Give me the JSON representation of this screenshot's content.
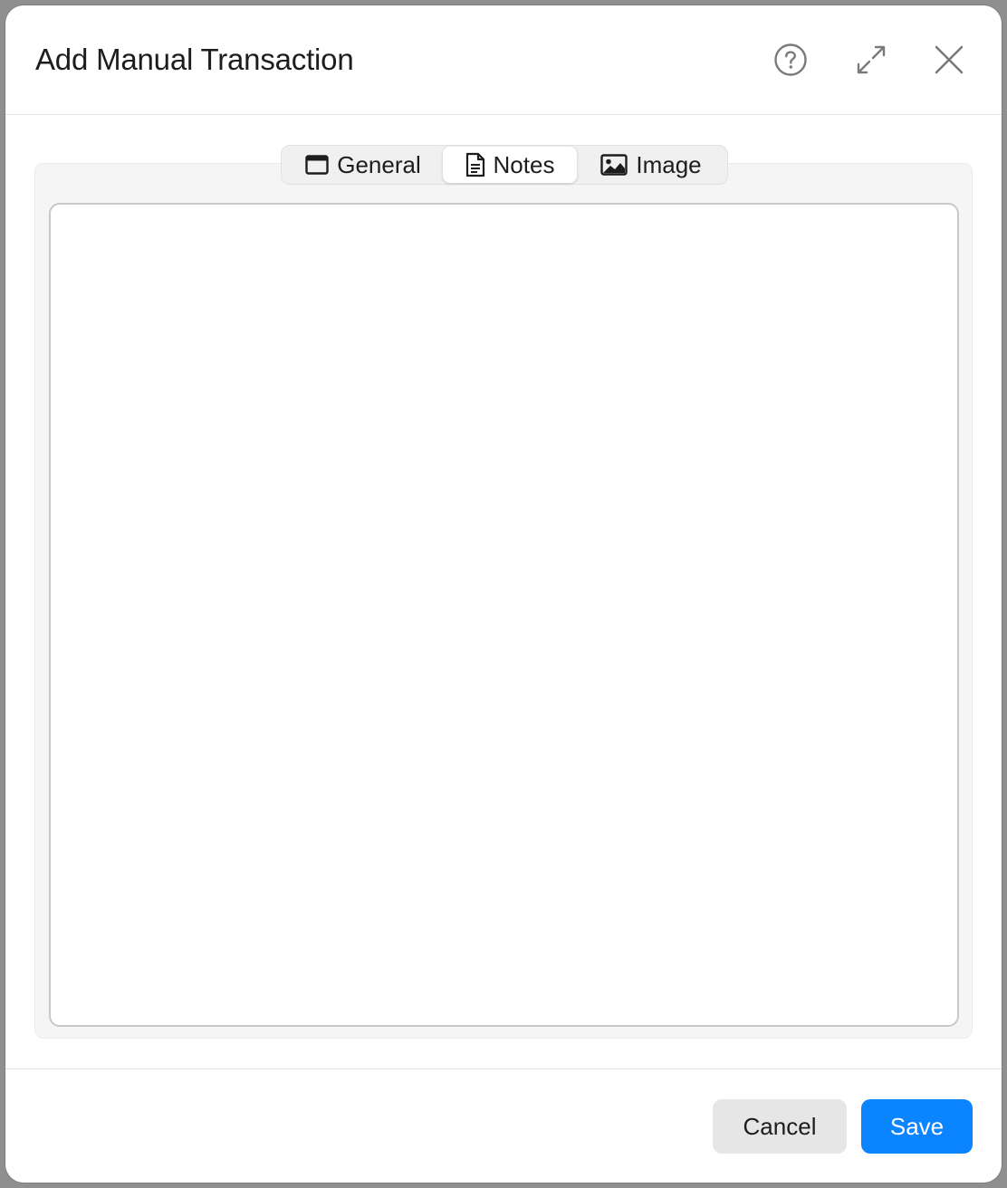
{
  "dialog": {
    "title": "Add Manual Transaction",
    "icons": {
      "help": "question-circle-icon",
      "expand": "expand-arrows-icon",
      "close": "close-x-icon"
    }
  },
  "tabs": [
    {
      "label": "General",
      "icon": "window-icon",
      "selected": false
    },
    {
      "label": "Notes",
      "icon": "document-icon",
      "selected": true
    },
    {
      "label": "Image",
      "icon": "photo-icon",
      "selected": false
    }
  ],
  "notes": {
    "value": "",
    "placeholder": ""
  },
  "footer": {
    "cancel_label": "Cancel",
    "save_label": "Save"
  },
  "colors": {
    "accent": "#0a84ff",
    "selected_tab_bg": "#ffffff",
    "panel_bg": "#f5f5f5"
  }
}
